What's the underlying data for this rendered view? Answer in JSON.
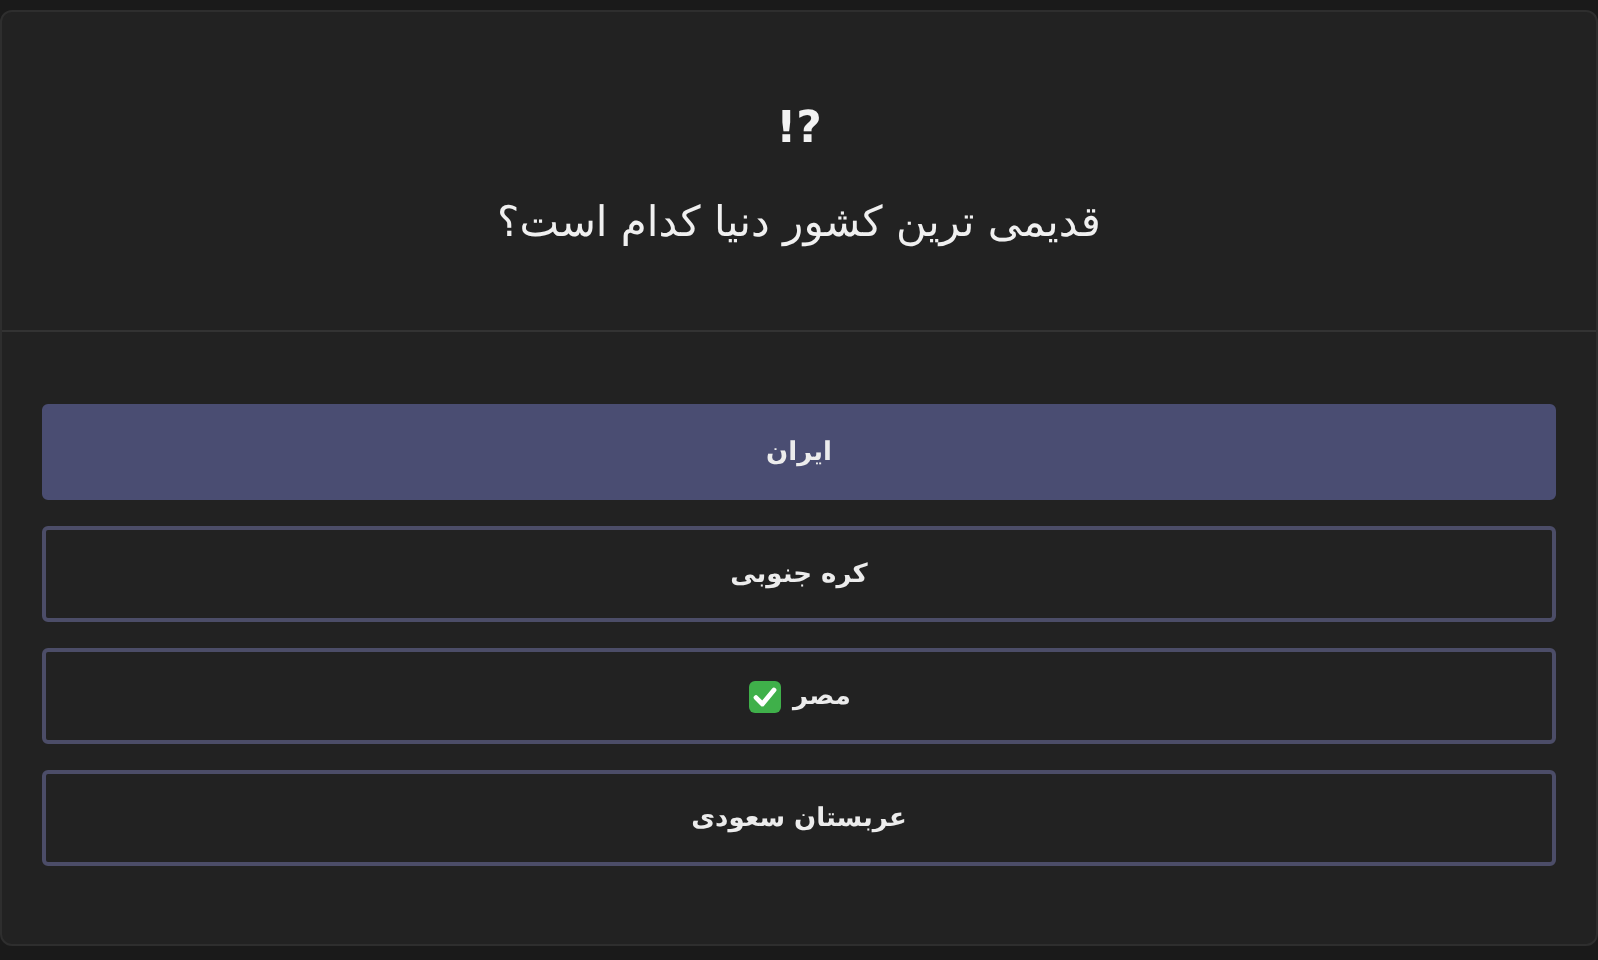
{
  "header": {
    "mark": "!?",
    "question": "قدیمی ترین کشور دنیا کدام است؟"
  },
  "options": [
    {
      "label": "ایران",
      "selected": true,
      "correct": false
    },
    {
      "label": "کره جنوبی",
      "selected": false,
      "correct": false
    },
    {
      "label": "مصر",
      "selected": false,
      "correct": true
    },
    {
      "label": "عربستان سعودی",
      "selected": false,
      "correct": false
    }
  ]
}
